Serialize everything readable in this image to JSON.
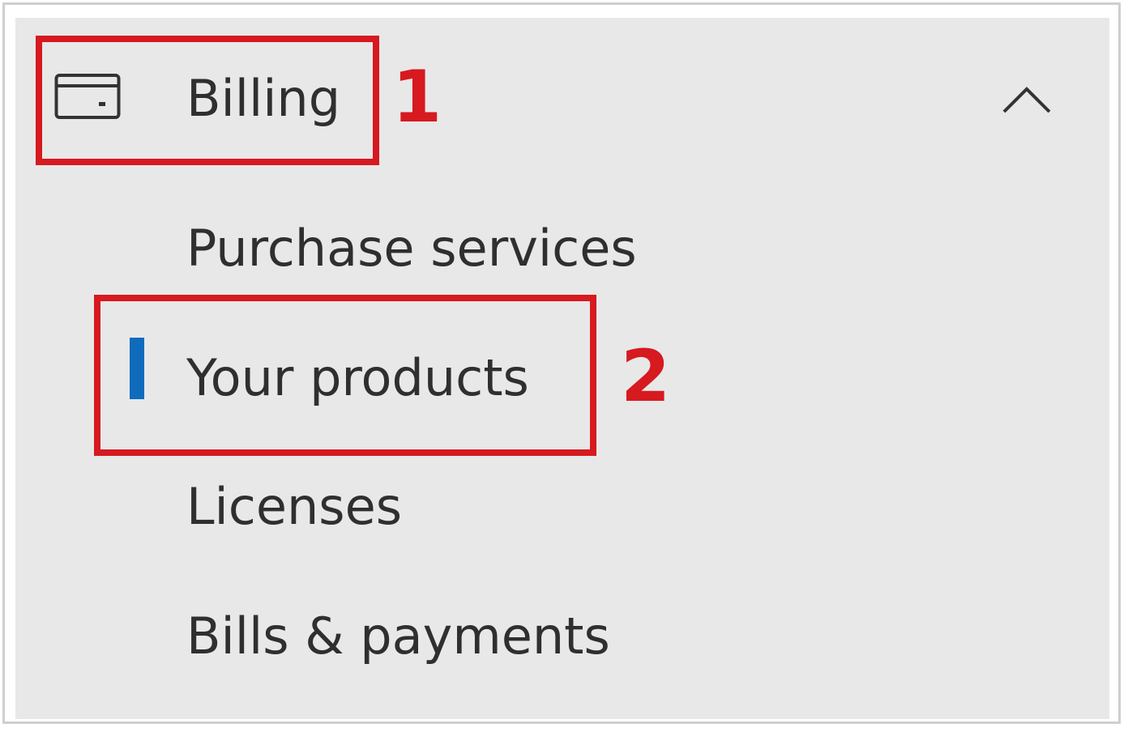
{
  "nav": {
    "billing": {
      "icon": "credit-card-icon",
      "label": "Billing",
      "expanded": true,
      "toggle_icon": "chevron-up-icon"
    },
    "items": [
      {
        "label": "Purchase services",
        "selected": false
      },
      {
        "label": "Your products",
        "selected": true
      },
      {
        "label": "Licenses",
        "selected": false
      },
      {
        "label": "Bills & payments",
        "selected": false
      }
    ]
  },
  "callouts": [
    {
      "number": "1",
      "target": "Billing"
    },
    {
      "number": "2",
      "target": "Your products"
    }
  ],
  "colors": {
    "panel_background": "#e8e8e8",
    "text": "#2f2f2f",
    "selection_indicator": "#0f6cbd",
    "callout": "#d71920"
  }
}
